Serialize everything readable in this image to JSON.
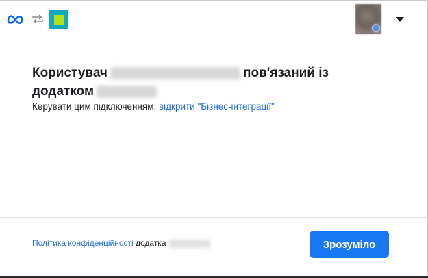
{
  "header": {
    "logo_icon": "meta-logo-icon",
    "link_icon": "link-arrows-icon",
    "app_icon": "app-icon",
    "avatar_icon": "user-avatar",
    "menu_icon": "caret-down-icon"
  },
  "main": {
    "title_prefix": "Користувач",
    "title_middle": "пов'язаний із",
    "title_line2": "додатком",
    "manage_text": "Керувати цим підключенням: ",
    "manage_link": "відкрити \"Бізнес-інтеграції\""
  },
  "footer": {
    "policy_link": "Політика конфіденційності",
    "policy_suffix": " додатка",
    "ok_label": "Зрозуміло"
  },
  "colors": {
    "accent": "#1877f2",
    "link": "#216fdb",
    "app_icon_outer": "#12a8c0",
    "app_icon_inner": "#b3e01c"
  }
}
